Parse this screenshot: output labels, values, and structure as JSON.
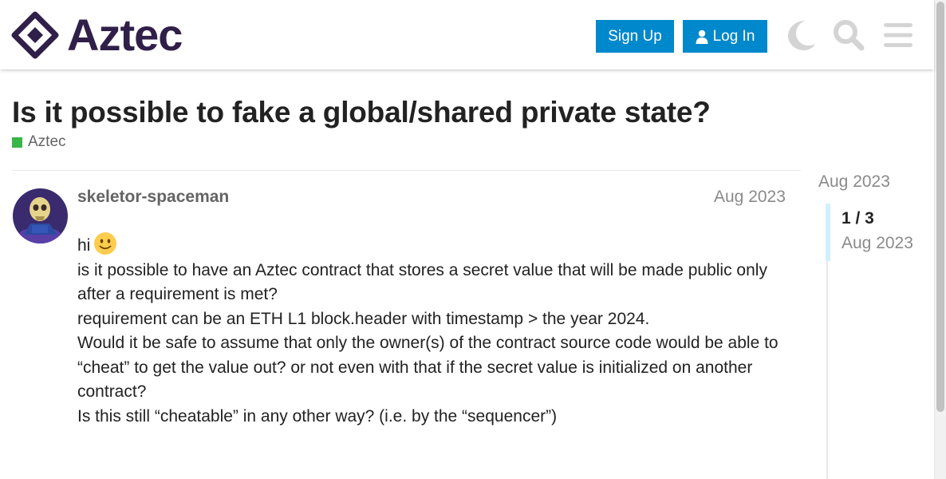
{
  "header": {
    "logo_text": "Aztec",
    "signup_label": "Sign Up",
    "login_label": "Log In",
    "icons": [
      "moon-icon",
      "search-icon",
      "hamburger-menu-icon"
    ],
    "accent_color": "#0088cc",
    "brand_color": "#2f1f49"
  },
  "topic": {
    "title": "Is it possible to fake a global/shared private state?",
    "category": "Aztec",
    "category_color": "#3ab54a"
  },
  "post": {
    "username": "skeletor-spaceman",
    "date": "Aug 2023",
    "lines": [
      "hi",
      "is it possible to have an Aztec contract that stores a secret value that will be made public only after a requirement is met?",
      "requirement can be an ETH L1 block.header with timestamp > the year 2024.",
      "Would it be safe to assume that only the owner(s) of the contract source code would be able to “cheat” to get the value out? or not even with that if the secret value is initialized on another contract?",
      "Is this still “cheatable” in any other way? (i.e. by the “sequencer”)"
    ],
    "emoji": "slightly-smiling-face"
  },
  "timeline": {
    "top_date": "Aug 2023",
    "counter": "1 / 3",
    "date": "Aug 2023"
  }
}
